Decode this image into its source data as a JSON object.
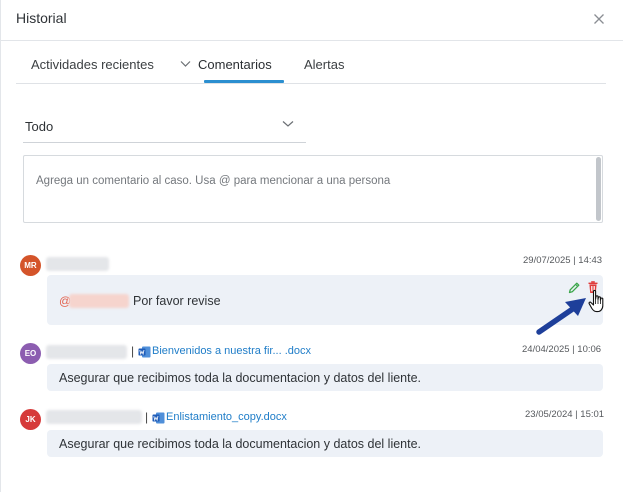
{
  "header": {
    "title": "Historial",
    "close_icon": "close-icon"
  },
  "tabs": [
    {
      "label": "Actividades recientes",
      "has_dropdown": true
    },
    {
      "label": "Comentarios",
      "active": true
    },
    {
      "label": "Alertas"
    }
  ],
  "filter": {
    "selected": "Todo"
  },
  "comment_input": {
    "placeholder": "Agrega un comentario al caso. Usa @ para mencionar a una persona"
  },
  "comments": [
    {
      "initials": "MR",
      "avatar_color": "#d4542a",
      "timestamp": "29/07/2025 | 14:43",
      "mention_prefix": "@",
      "text": "Por favor revise",
      "actions": [
        "pencil-icon",
        "trash-icon"
      ]
    },
    {
      "initials": "EO",
      "avatar_color": "#8c5db0",
      "attachment": "Bienvenidos a nuestra fir... .docx",
      "timestamp": "24/04/2025 | 10:06",
      "text": "Asegurar que recibimos toda la documentacion y datos del liente."
    },
    {
      "initials": "JK",
      "avatar_color": "#d63a3a",
      "attachment": "Enlistamiento_copy.docx",
      "timestamp": "23/05/2024 | 15:01",
      "text": "Asegurar que recibimos toda la documentacion y datos del liente."
    }
  ],
  "colors": {
    "accent": "#2b8fd0",
    "edit": "#3aa64a",
    "delete": "#e03a3a",
    "annotation_arrow": "#1e3f9a"
  }
}
